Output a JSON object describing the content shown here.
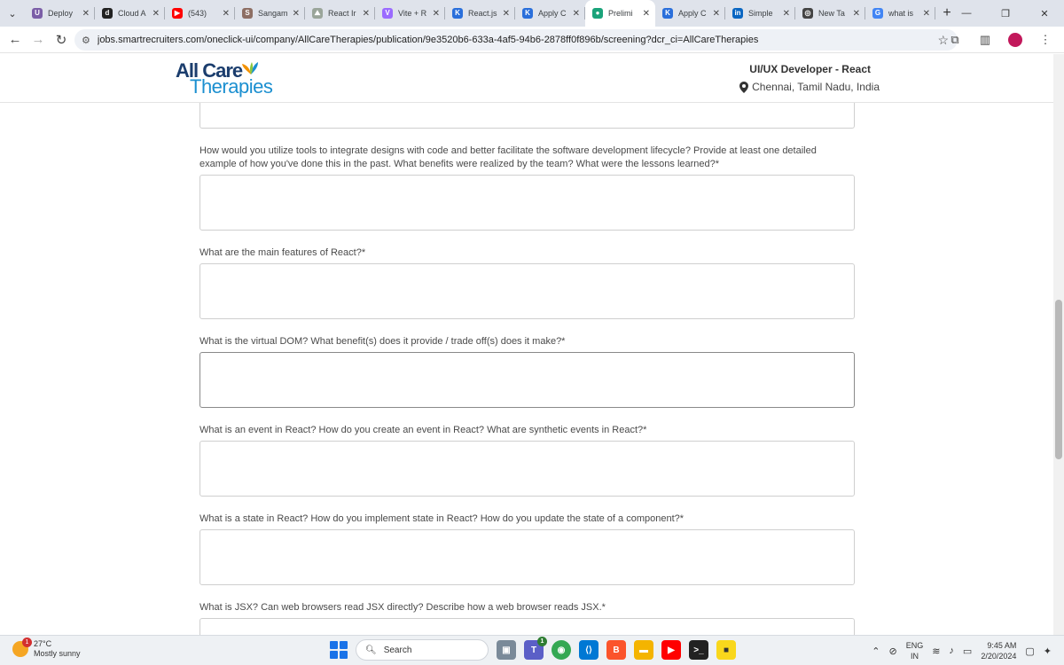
{
  "browser": {
    "tabs": [
      {
        "title": "Deploy",
        "color": "#7b5ea7",
        "glyph": "U"
      },
      {
        "title": "Cloud A",
        "color": "#222222",
        "glyph": "d"
      },
      {
        "title": "(543)",
        "color": "#ff0000",
        "glyph": "▶"
      },
      {
        "title": "Sangam",
        "color": "#8d6e63",
        "glyph": "S"
      },
      {
        "title": "React Ir",
        "color": "#9aa59a",
        "glyph": "⛰"
      },
      {
        "title": "Vite + R",
        "color": "#9b6bff",
        "glyph": "V"
      },
      {
        "title": "React.js",
        "color": "#2a6fdb",
        "glyph": "K"
      },
      {
        "title": "Apply C",
        "color": "#2a6fdb",
        "glyph": "K"
      },
      {
        "title": "Prelimi",
        "color": "#1aa37a",
        "glyph": "●"
      },
      {
        "title": "Apply C",
        "color": "#2a6fdb",
        "glyph": "K"
      },
      {
        "title": "Simple",
        "color": "#0a66c2",
        "glyph": "in"
      },
      {
        "title": "New Ta",
        "color": "#444444",
        "glyph": "◎"
      },
      {
        "title": "what is",
        "color": "#4285f4",
        "glyph": "G"
      }
    ],
    "active_tab_index": 8,
    "url": "jobs.smartrecruiters.com/oneclick-ui/company/AllCareTherapies/publication/9e3520b6-633a-4af5-94b6-2878ff0f896b/screening?dcr_ci=AllCareTherapies"
  },
  "header": {
    "logo_line1": "All Care",
    "logo_line2": "Therapies",
    "job_title": "UI/UX Developer - React",
    "job_location": "Chennai, Tamil Nadu, India"
  },
  "questions": [
    {
      "label": "How would you utilize tools to integrate designs with code and better facilitate the software development lifecycle? Provide at least one detailed example of how you've done this in the past. What benefits were realized by the team? What were the lessons learned?*",
      "value": ""
    },
    {
      "label": "What are the main features of React?*",
      "value": ""
    },
    {
      "label": "What is the virtual DOM? What benefit(s) does it provide / trade off(s) does it make?*",
      "value": ""
    },
    {
      "label": "What is an event in React? How do you create an event in React? What are synthetic events in React?*",
      "value": ""
    },
    {
      "label": "What is a state in React? How do you implement state in React? How do you update the state of a component?*",
      "value": ""
    },
    {
      "label": "What is JSX? Can web browsers read JSX directly? Describe how a web browser reads JSX.*",
      "value": ""
    }
  ],
  "taskbar": {
    "weather_temp": "27°C",
    "weather_desc": "Mostly sunny",
    "weather_badge": "1",
    "search_label": "Search",
    "lang_line1": "ENG",
    "lang_line2": "IN",
    "time": "9:45 AM",
    "date": "2/20/2024",
    "teams_badge": "1"
  }
}
